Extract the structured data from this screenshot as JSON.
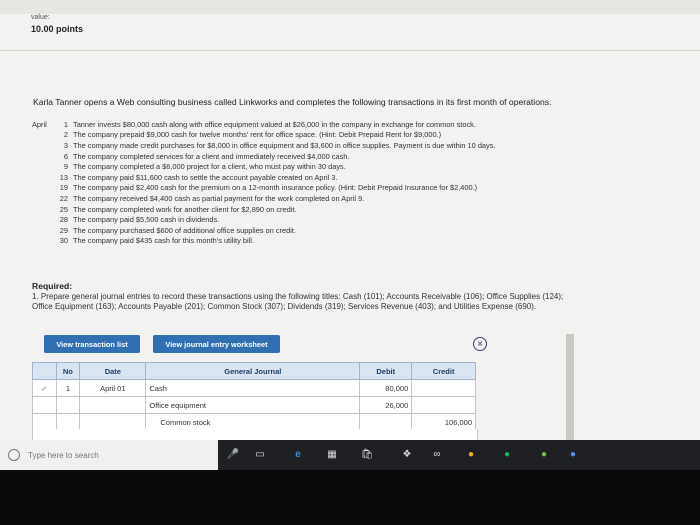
{
  "header": {
    "value_label": "value:",
    "points": "10.00 points"
  },
  "intro": "Karla Tanner opens a Web consulting business called Linkworks and completes the following transactions in its first month of operations.",
  "transactions": [
    {
      "month": "April",
      "day": "1",
      "text": "Tanner invests $80,000 cash along with office equipment valued at $26,000 in the company in exchange for common stock."
    },
    {
      "month": "",
      "day": "2",
      "text": "The company prepaid $9,000 cash for twelve months' rent for office space. (Hint: Debit Prepaid Rent for $9,000.)"
    },
    {
      "month": "",
      "day": "3",
      "text": "The company made credit purchases for $8,000 in office equipment and $3,600 in office supplies. Payment is due within 10 days."
    },
    {
      "month": "",
      "day": "6",
      "text": "The company completed services for a client and immediately received $4,000 cash."
    },
    {
      "month": "",
      "day": "9",
      "text": "The company completed a $6,000 project for a client, who must pay within 30 days."
    },
    {
      "month": "",
      "day": "13",
      "text": "The company paid $11,600 cash to settle the account payable created on April 3."
    },
    {
      "month": "",
      "day": "19",
      "text": "The company paid $2,400 cash for the premium on a 12-month insurance policy. (Hint: Debit Prepaid Insurance for $2,400.)"
    },
    {
      "month": "",
      "day": "22",
      "text": "The company received $4,400 cash as partial payment for the work completed on April 9."
    },
    {
      "month": "",
      "day": "25",
      "text": "The company completed work for another client for $2,890 on credit."
    },
    {
      "month": "",
      "day": "28",
      "text": "The company paid $5,500 cash in dividends."
    },
    {
      "month": "",
      "day": "29",
      "text": "The company purchased $600 of additional office supplies on credit."
    },
    {
      "month": "",
      "day": "30",
      "text": "The company paid $435 cash for this month's utility bill."
    }
  ],
  "required": {
    "label": "Required:",
    "line1": "1. Prepare general journal entries to record these transactions using the following titles: Cash (101); Accounts Receivable (106); Office Supplies (124);",
    "line2": "Office Equipment (163); Accounts Payable (201); Common Stock (307); Dividends (319); Services Revenue (403); and Utilities Expense (690)."
  },
  "buttons": {
    "view_transactions": "View transaction list",
    "view_journal": "View journal entry worksheet",
    "close": "×"
  },
  "journal": {
    "headers": {
      "no": "No",
      "date": "Date",
      "general_journal": "General Journal",
      "debit": "Debit",
      "credit": "Credit"
    },
    "rows": [
      {
        "edit": "✓",
        "no": "1",
        "date": "April 01",
        "account": "Cash",
        "debit": "80,000",
        "credit": "",
        "indent": false
      },
      {
        "edit": "",
        "no": "",
        "date": "",
        "account": "Office equipment",
        "debit": "26,000",
        "credit": "",
        "indent": false
      },
      {
        "edit": "",
        "no": "",
        "date": "",
        "account": "Common stock",
        "debit": "",
        "credit": "106,000",
        "indent": true
      }
    ]
  },
  "taskbar": {
    "search_placeholder": "Type here to search"
  },
  "colors": {
    "accent": "#2f6fb2",
    "header_bg": "#d9e5f2",
    "taskbar": "#1f2024"
  }
}
